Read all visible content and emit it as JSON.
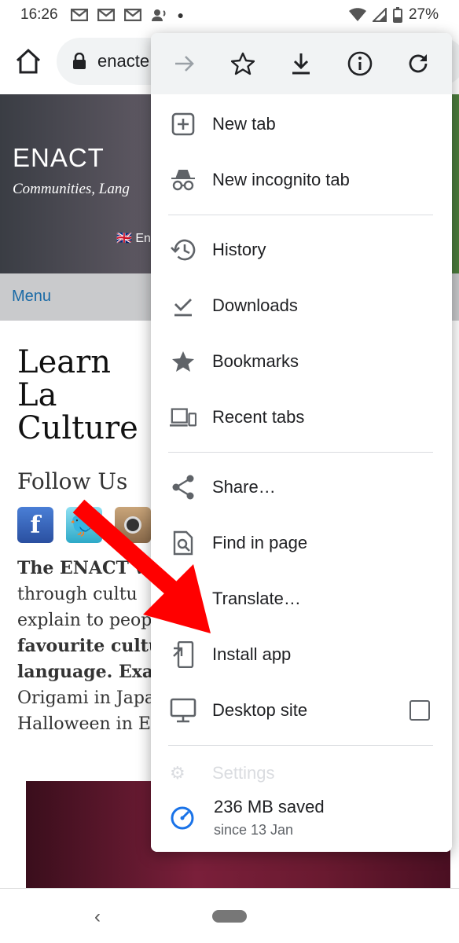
{
  "status_bar": {
    "time": "16:26",
    "battery": "27%"
  },
  "toolbar": {
    "url": "enacte"
  },
  "site": {
    "title": "ENACT",
    "tagline": "Communities, Lang",
    "language": "🇬🇧 En",
    "menu_label": "Menu",
    "heading": "Learn La Culture",
    "follow": "Follow Us",
    "social": [
      "f",
      "t",
      ""
    ],
    "body_lines": [
      "The ENACT wel",
      "through cultu",
      "explain to peopl",
      "favourite cultu",
      "language. Exam",
      "Origami in Japa",
      "Halloween in En"
    ]
  },
  "menu": {
    "items_group1": [
      {
        "label": "New tab",
        "icon": "new-tab-icon"
      },
      {
        "label": "New incognito tab",
        "icon": "incognito-icon"
      }
    ],
    "items_group2": [
      {
        "label": "History",
        "icon": "history-icon"
      },
      {
        "label": "Downloads",
        "icon": "downloads-icon"
      },
      {
        "label": "Bookmarks",
        "icon": "bookmarks-icon"
      },
      {
        "label": "Recent tabs",
        "icon": "recent-tabs-icon"
      }
    ],
    "items_group3": [
      {
        "label": "Share…",
        "icon": "share-icon"
      },
      {
        "label": "Find in page",
        "icon": "find-in-page-icon"
      },
      {
        "label": "Translate…",
        "icon": "translate-icon"
      },
      {
        "label": "Install app",
        "icon": "install-app-icon"
      },
      {
        "label": "Desktop site",
        "icon": "desktop-site-icon",
        "checked": false
      }
    ],
    "settings_label": "Settings",
    "saved": {
      "amount": "236 MB saved",
      "since": "since 13 Jan"
    }
  },
  "colors": {
    "accent": "#1a73e8",
    "arrow": "#ff0000",
    "link": "#1a6aa6"
  }
}
